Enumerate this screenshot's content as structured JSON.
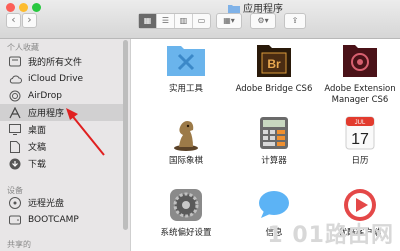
{
  "window": {
    "title": "应用程序"
  },
  "toolbar": {
    "back": "‹",
    "forward": "›",
    "view_modes": [
      "icon-view",
      "list-view",
      "column-view",
      "cover-flow-view"
    ],
    "arrange": "arrange",
    "action": "action"
  },
  "sidebar": {
    "favorites_title": "个人收藏",
    "favorites": [
      {
        "label": "我的所有文件",
        "icon": "all-files-icon"
      },
      {
        "label": "iCloud Drive",
        "icon": "cloud-icon"
      },
      {
        "label": "AirDrop",
        "icon": "airdrop-icon"
      },
      {
        "label": "应用程序",
        "icon": "applications-icon",
        "selected": true
      },
      {
        "label": "桌面",
        "icon": "desktop-icon"
      },
      {
        "label": "文稿",
        "icon": "documents-icon"
      },
      {
        "label": "下载",
        "icon": "downloads-icon"
      }
    ],
    "devices_title": "设备",
    "devices": [
      {
        "label": "远程光盘",
        "icon": "disc-icon"
      },
      {
        "label": "BOOTCAMP",
        "icon": "disk-icon"
      }
    ],
    "shared_title": "共享的"
  },
  "apps": [
    {
      "label": "实用工具",
      "icon": "utilities-folder-icon",
      "color": "#5aa9e6"
    },
    {
      "label": "Adobe Bridge CS6",
      "icon": "adobe-bridge-icon",
      "color": "#3a2410"
    },
    {
      "label": "Adobe Extension Manager CS6",
      "icon": "adobe-extension-manager-icon",
      "color": "#5a1a20"
    },
    {
      "label": "国际象棋",
      "icon": "chess-icon",
      "color": "#8a6a40"
    },
    {
      "label": "计算器",
      "icon": "calculator-icon",
      "color": "#555555"
    },
    {
      "label": "日历",
      "icon": "calendar-icon",
      "color": "#e23b2e"
    },
    {
      "label": "系统偏好设置",
      "icon": "system-preferences-icon",
      "color": "#777777"
    },
    {
      "label": "信息",
      "icon": "messages-icon",
      "color": "#4aa3f0"
    },
    {
      "label": "优酷客户端",
      "icon": "youku-icon",
      "color": "#e04040"
    }
  ],
  "calendar": {
    "month": "JUL",
    "day": "17"
  },
  "adobe": {
    "bridge_abbr": "Br"
  },
  "watermark": "1 01路由网",
  "colors": {
    "annotation_arrow": "#e02020",
    "selection": "#d1d0d1"
  }
}
